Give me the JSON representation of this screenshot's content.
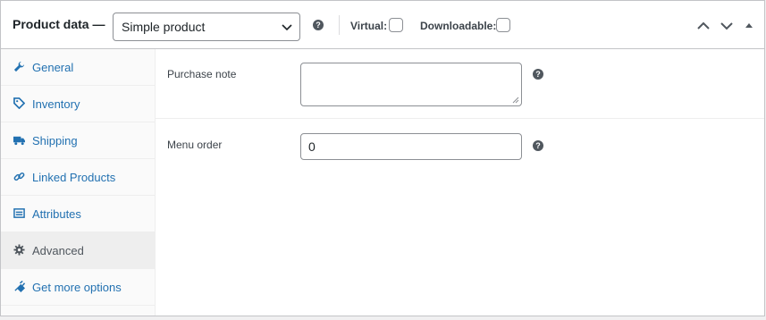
{
  "header": {
    "title": "Product data —",
    "product_type": "Simple product",
    "virtual_label": "Virtual:",
    "downloadable_label": "Downloadable:",
    "virtual_checked": false,
    "downloadable_checked": false
  },
  "sidebar": {
    "items": [
      {
        "label": "General",
        "icon": "wrench-icon",
        "active": false
      },
      {
        "label": "Inventory",
        "icon": "tag-icon",
        "active": false
      },
      {
        "label": "Shipping",
        "icon": "truck-icon",
        "active": false
      },
      {
        "label": "Linked Products",
        "icon": "link-icon",
        "active": false
      },
      {
        "label": "Attributes",
        "icon": "list-icon",
        "active": false
      },
      {
        "label": "Advanced",
        "icon": "gear-icon",
        "active": true
      },
      {
        "label": "Get more options",
        "icon": "plug-icon",
        "active": false
      }
    ]
  },
  "fields": {
    "purchase_note_label": "Purchase note",
    "purchase_note_value": "",
    "menu_order_label": "Menu order",
    "menu_order_value": "0"
  },
  "colors": {
    "link": "#2271b1",
    "active_tab_bg": "#eeeeee",
    "border": "#c3c4c7",
    "help_icon": "#50575e"
  }
}
